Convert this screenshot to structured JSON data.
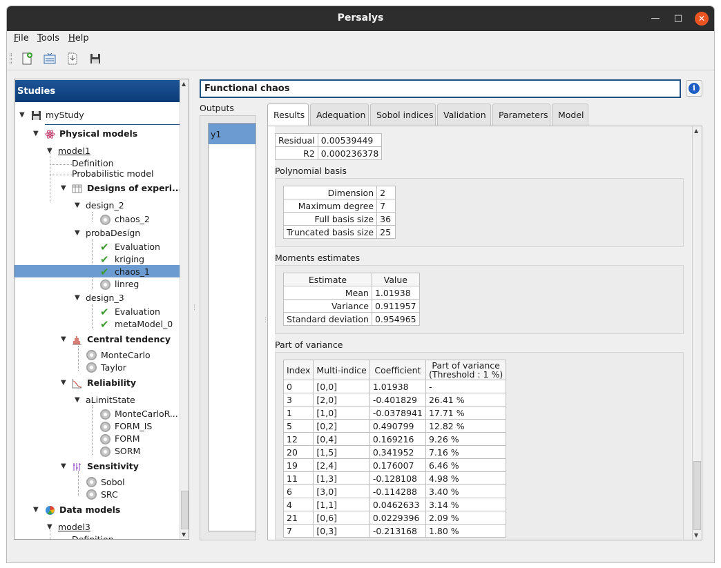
{
  "window": {
    "title": "Persalys"
  },
  "menu": [
    "File",
    "Tools",
    "Help"
  ],
  "toolbar": {
    "icons": [
      "new-study-icon",
      "open-study-icon",
      "import-script-icon",
      "save-icon"
    ]
  },
  "studies_panel": {
    "header": "Studies",
    "tree": {
      "study": "myStudy",
      "physical_models": "Physical models",
      "model1": "model1",
      "definition": "Definition",
      "probabilistic_model": "Probabilistic model",
      "designs": "Designs of experi...",
      "design_2": "design_2",
      "chaos_2": "chaos_2",
      "probaDesign": "probaDesign",
      "evaluation": "Evaluation",
      "kriging": "kriging",
      "chaos_1": "chaos_1",
      "linreg": "linreg",
      "design_3": "design_3",
      "evaluation_2": "Evaluation",
      "metaModel_0": "metaModel_0",
      "central_tendency": "Central tendency",
      "montecarlo": "MonteCarlo",
      "taylor": "Taylor",
      "reliability": "Reliability",
      "aLimitState": "aLimitState",
      "montecarlo_r": "MonteCarloR...",
      "form_is": "FORM_IS",
      "form": "FORM",
      "sorm": "SORM",
      "sensitivity": "Sensitivity",
      "sobol": "Sobol",
      "src": "SRC",
      "data_models": "Data models",
      "model3": "model3",
      "definition_3": "Definition"
    }
  },
  "analysis": {
    "title": "Functional chaos",
    "outputs_label": "Outputs",
    "outputs": [
      "y1"
    ],
    "tabs": [
      "Results",
      "Adequation",
      "Sobol indices",
      "Validation",
      "Parameters",
      "Model"
    ],
    "active_tab": "Results",
    "residual_table": [
      {
        "label": "Residual",
        "value": "0.00539449"
      },
      {
        "label": "R2",
        "value": "0.000236378"
      }
    ],
    "polynomial_basis": {
      "label": "Polynomial basis",
      "rows": [
        {
          "label": "Dimension",
          "value": "2"
        },
        {
          "label": "Maximum degree",
          "value": "7"
        },
        {
          "label": "Full basis size",
          "value": "36"
        },
        {
          "label": "Truncated basis size",
          "value": "25"
        }
      ]
    },
    "moments": {
      "label": "Moments estimates",
      "headers": [
        "Estimate",
        "Value"
      ],
      "rows": [
        {
          "label": "Mean",
          "value": "1.01938"
        },
        {
          "label": "Variance",
          "value": "0.911957"
        },
        {
          "label": "Standard deviation",
          "value": "0.954965"
        }
      ]
    },
    "variance": {
      "label": "Part of variance",
      "headers": [
        "Index",
        "Multi-indice",
        "Coefficient",
        "Part of variance",
        "(Threshold : 1 %)"
      ],
      "rows": [
        [
          "0",
          "[0,0]",
          "1.01938",
          "-"
        ],
        [
          "3",
          "[2,0]",
          "-0.401829",
          "26.41 %"
        ],
        [
          "1",
          "[1,0]",
          "-0.0378941",
          "17.71 %"
        ],
        [
          "5",
          "[0,2]",
          "0.490799",
          "12.82 %"
        ],
        [
          "12",
          "[0,4]",
          "0.169216",
          "9.26 %"
        ],
        [
          "20",
          "[1,5]",
          "0.341952",
          "7.16 %"
        ],
        [
          "19",
          "[2,4]",
          "0.176007",
          "6.46 %"
        ],
        [
          "11",
          "[1,3]",
          "-0.128108",
          "4.98 %"
        ],
        [
          "6",
          "[3,0]",
          "-0.114288",
          "3.40 %"
        ],
        [
          "4",
          "[1,1]",
          "0.0462633",
          "3.14 %"
        ],
        [
          "21",
          "[0,6]",
          "0.0229396",
          "2.09 %"
        ],
        [
          "7",
          "[0,3]",
          "-0.213168",
          "1.80 %"
        ]
      ]
    }
  }
}
